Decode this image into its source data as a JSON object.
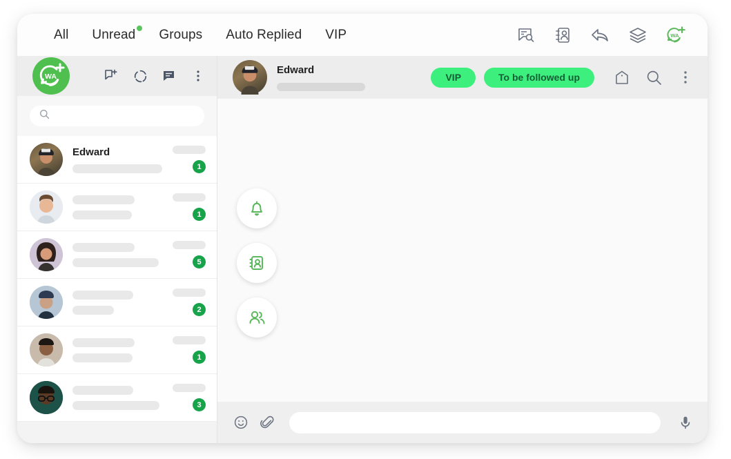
{
  "topbar": {
    "tabs": [
      {
        "label": "All",
        "has_dot": false
      },
      {
        "label": "Unread",
        "has_dot": true
      },
      {
        "label": "Groups",
        "has_dot": false
      },
      {
        "label": "Auto Replied",
        "has_dot": false
      },
      {
        "label": "VIP",
        "has_dot": false
      }
    ],
    "icons": [
      {
        "name": "message-search-icon"
      },
      {
        "name": "contact-card-icon"
      },
      {
        "name": "reply-arrow-icon"
      },
      {
        "name": "layers-stack-icon"
      },
      {
        "name": "wa-plus-logo-icon"
      }
    ]
  },
  "sidebar": {
    "logo": {
      "name": "wa-plus-avatar",
      "text": "WA"
    },
    "header_icons": [
      {
        "name": "new-chat-icon"
      },
      {
        "name": "status-ring-icon"
      },
      {
        "name": "chat-bubble-icon"
      },
      {
        "name": "overflow-menu-icon"
      }
    ],
    "search": {
      "value": "",
      "placeholder": ""
    },
    "chats": [
      {
        "name": "Edward",
        "badge": "1",
        "selected": true,
        "line1_w": 0,
        "line2_w": 130,
        "time_w": 48
      },
      {
        "name": "",
        "badge": "1",
        "selected": false,
        "line1_w": 90,
        "line2_w": 86,
        "time_w": 48
      },
      {
        "name": "",
        "badge": "5",
        "selected": false,
        "line1_w": 90,
        "line2_w": 125,
        "time_w": 48
      },
      {
        "name": "",
        "badge": "2",
        "selected": false,
        "line1_w": 88,
        "line2_w": 60,
        "time_w": 48
      },
      {
        "name": "",
        "badge": "1",
        "selected": false,
        "line1_w": 90,
        "line2_w": 87,
        "time_w": 48
      },
      {
        "name": "",
        "badge": "3",
        "selected": false,
        "line1_w": 88,
        "line2_w": 126,
        "time_w": 48
      }
    ]
  },
  "chat": {
    "contact_name": "Edward",
    "tags": [
      {
        "label": "VIP"
      },
      {
        "label": "To be followed up"
      }
    ],
    "header_icons": [
      {
        "name": "tag-icon"
      },
      {
        "name": "search-icon"
      },
      {
        "name": "overflow-menu-icon"
      }
    ],
    "quick_actions": [
      {
        "name": "bell-icon"
      },
      {
        "name": "contact-book-icon"
      },
      {
        "name": "group-people-icon"
      }
    ],
    "composer": {
      "emoji_icon": "emoji-icon",
      "attach_icon": "paperclip-icon",
      "mic_icon": "microphone-icon",
      "input_value": "",
      "input_placeholder": ""
    }
  },
  "colors": {
    "brand_green": "#4FBF4F",
    "badge_green": "#16a34a",
    "tag_green": "#3DF07E",
    "accent_icon_green": "#5CB85C"
  }
}
